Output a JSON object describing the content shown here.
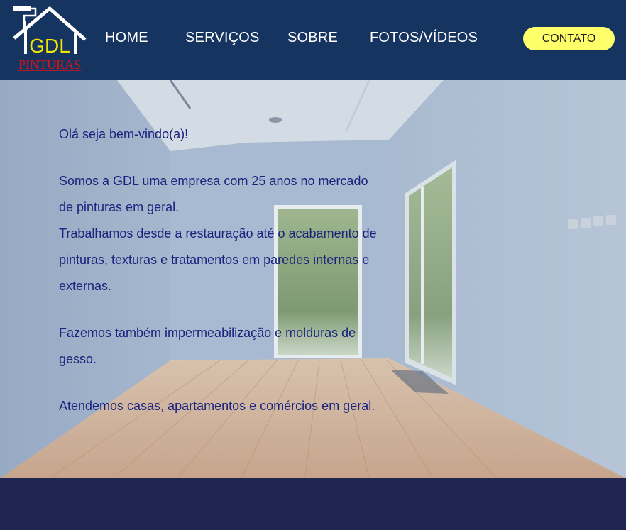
{
  "brand": {
    "logo_main": "GDL",
    "logo_sub": "PINTURAS"
  },
  "nav": {
    "items": [
      {
        "label": "HOME"
      },
      {
        "label": "SERVIÇOS"
      },
      {
        "label": "SOBRE"
      },
      {
        "label": "FOTOS/VÍDEOS"
      }
    ],
    "contact_label": "CONTATO"
  },
  "hero": {
    "greeting": "Olá seja bem-vindo(a)!",
    "para1_line1": "Somos a GDL uma empresa com 25 anos no mercado de pinturas em geral.",
    "para1_line2": "Trabalhamos desde a restauração até o acabamento de pinturas, texturas e tratamentos em paredes internas e externas.",
    "para2": "Fazemos também impermeabilização e molduras de gesso.",
    "para3": "Atendemos casas, apartamentos e comércios em geral."
  },
  "colors": {
    "header_bg": "#15345f",
    "contact_bg": "#ffff6a",
    "hero_text": "#1a237e",
    "footer_bg": "#1f2750",
    "logo_yellow": "#f2e600",
    "logo_red": "#d8121b"
  },
  "icons": {
    "logo": "house-with-paint-roller-icon"
  }
}
